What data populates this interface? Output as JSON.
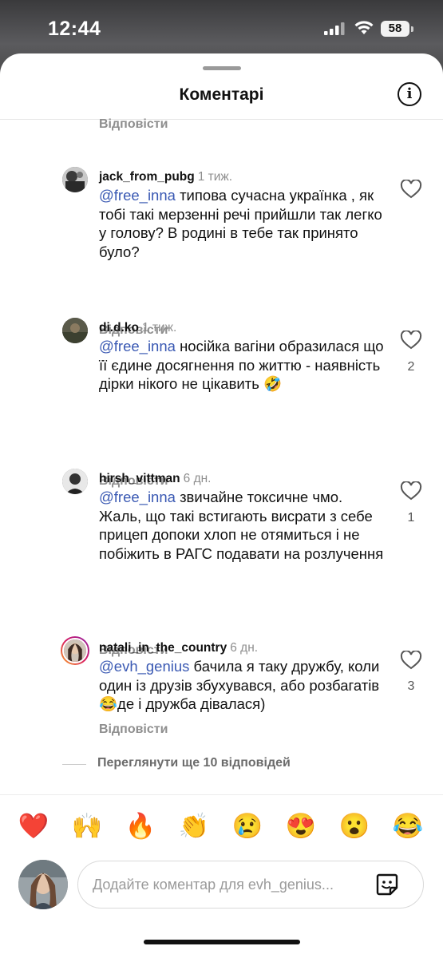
{
  "status": {
    "time": "12:44",
    "battery": "58"
  },
  "header": {
    "title": "Коментарі"
  },
  "reply_label": "Відповісти",
  "comments": [
    {
      "username": "jack_from_pubg",
      "ago": "1 тиж.",
      "mention": "@free_inna",
      "text": " типова сучасна українка , як тобі такі мерзенні речі прийшли так легко у голову? В родині в тебе так принято було?",
      "likes": ""
    },
    {
      "username": "di.d.ko",
      "ago": "1 тиж.",
      "mention": "@free_inna",
      "text": " носійка вагіни образилася що її єдине досягнення по життю - наявність дірки нікого не цікавить 🤣",
      "likes": "2"
    },
    {
      "username": "hirsh_vittman",
      "ago": "6 дн.",
      "mention": "@free_inna",
      "text": " звичайне токсичне чмо. Жаль, що такі встигають висрати з себе прицеп допоки хлоп не отямиться і не побіжить в РАГС подавати на розлучення",
      "likes": "1"
    },
    {
      "username": "natali_in_the_country",
      "ago": "6 дн.",
      "mention": "@evh_genius",
      "text": " бачила я таку дружбу, коли один із друзів збухувався, або розбагатів 😂де і дружба дівалася)",
      "likes": "3"
    }
  ],
  "more_replies": "Переглянути ще 10 відповідей",
  "emojis": [
    "❤️",
    "🙌",
    "🔥",
    "👏",
    "😢",
    "😍",
    "😮",
    "😂"
  ],
  "compose": {
    "placeholder": "Додайте коментар для evh_genius..."
  },
  "icons": {
    "like": "heart-outline-icon",
    "info": "info-circle-icon",
    "sticker": "sticker-icon"
  }
}
